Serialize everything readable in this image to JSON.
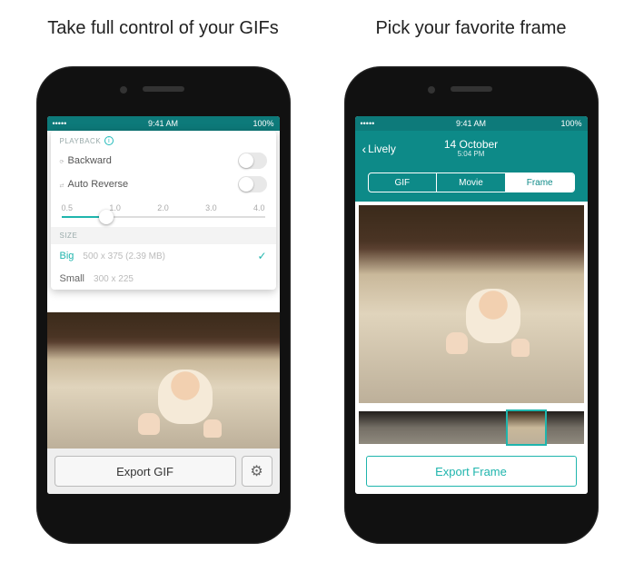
{
  "headlines": {
    "left": "Take full control of your GIFs",
    "right": "Pick your favorite frame"
  },
  "statusbar": {
    "carrier": "•••••",
    "signal_icon": "wifi-icon",
    "time": "9:41 AM",
    "battery_text": "100%",
    "battery_icon": "battery-icon"
  },
  "left_screen": {
    "panel": {
      "playback_header": "PLAYBACK",
      "toggles": [
        {
          "label": "Backward",
          "on": false
        },
        {
          "label": "Auto Reverse",
          "on": false
        }
      ],
      "speed_marks": [
        "0.5",
        "1.0",
        "2.0",
        "3.0",
        "4.0"
      ],
      "speed_value": "1.0",
      "size_header": "SIZE",
      "sizes": [
        {
          "name": "Big",
          "dim": "500 x 375 (2.39 MB)",
          "selected": true
        },
        {
          "name": "Small",
          "dim": "300 x 225",
          "selected": false
        }
      ]
    },
    "export_label": "Export GIF"
  },
  "right_screen": {
    "back_label": "Lively",
    "title": "14 October",
    "subtitle": "5:04 PM",
    "segments": [
      {
        "label": "GIF",
        "active": false
      },
      {
        "label": "Movie",
        "active": false
      },
      {
        "label": "Frame",
        "active": true
      }
    ],
    "filmstrip_count": 6,
    "filmstrip_selected_index": 4,
    "export_label": "Export Frame"
  }
}
